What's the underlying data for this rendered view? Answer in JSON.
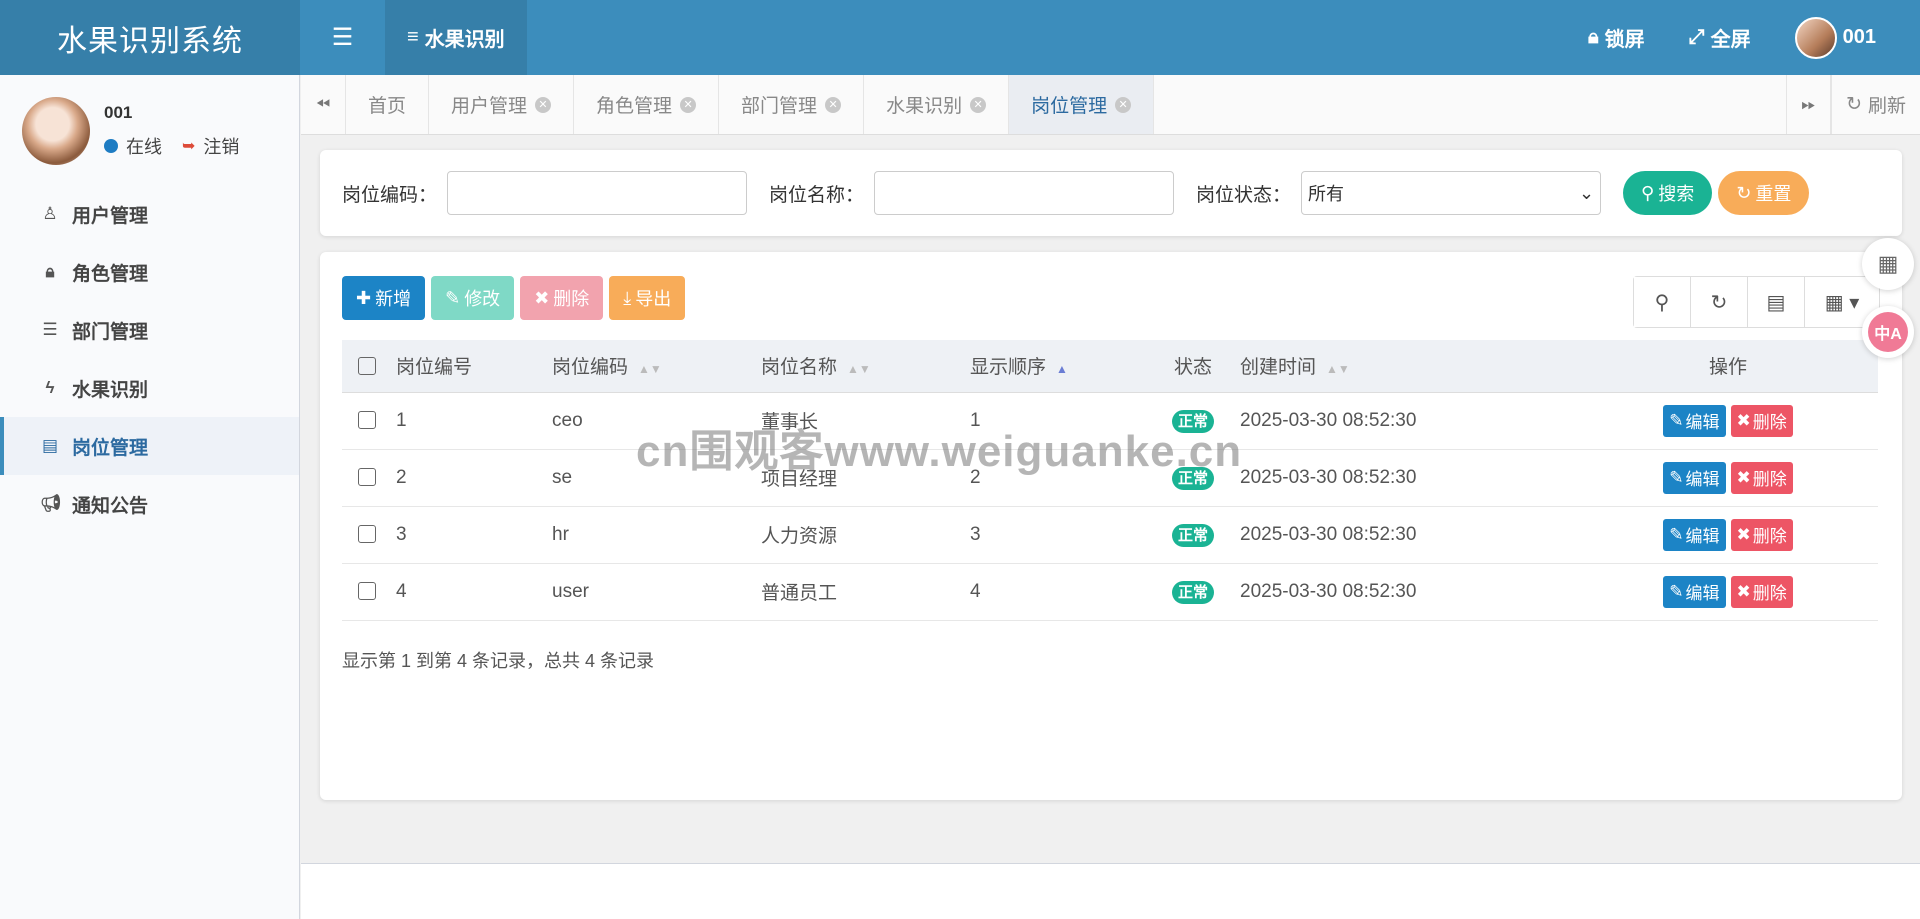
{
  "app": {
    "title": "水果识别系统"
  },
  "topbar": {
    "menu_tab": "水果识别",
    "lock_label": "锁屏",
    "fullscreen_label": "全屏",
    "user_label": "001"
  },
  "sidebar": {
    "user": {
      "name": "001",
      "status": "在线",
      "logout": "注销"
    },
    "items": [
      {
        "label": "用户管理",
        "icon": "user-icon"
      },
      {
        "label": "角色管理",
        "icon": "lock-icon"
      },
      {
        "label": "部门管理",
        "icon": "outdent-icon"
      },
      {
        "label": "水果识别",
        "icon": "bolt-icon"
      },
      {
        "label": "岗位管理",
        "icon": "id-card-icon",
        "active": true
      },
      {
        "label": "通知公告",
        "icon": "bullhorn-icon"
      }
    ]
  },
  "tabs": {
    "items": [
      "首页",
      "用户管理",
      "角色管理",
      "部门管理",
      "水果识别",
      "岗位管理"
    ],
    "active": "岗位管理",
    "refresh_label": "刷新"
  },
  "search": {
    "post_code_label": "岗位编码：",
    "post_code_value": "",
    "post_name_label": "岗位名称：",
    "post_name_value": "",
    "status_label": "岗位状态：",
    "status_selected": "所有",
    "search_button": "搜索",
    "reset_button": "重置"
  },
  "toolbar": {
    "add": "新增",
    "edit": "修改",
    "delete": "删除",
    "export": "导出"
  },
  "table": {
    "columns": [
      "岗位编号",
      "岗位编码",
      "岗位名称",
      "显示顺序",
      "状态",
      "创建时间",
      "操作"
    ],
    "rows": [
      {
        "id": "1",
        "code": "ceo",
        "name": "董事长",
        "order": "1",
        "status": "正常",
        "created": "2025-03-30 08:52:30"
      },
      {
        "id": "2",
        "code": "se",
        "name": "项目经理",
        "order": "2",
        "status": "正常",
        "created": "2025-03-30 08:52:30"
      },
      {
        "id": "3",
        "code": "hr",
        "name": "人力资源",
        "order": "3",
        "status": "正常",
        "created": "2025-03-30 08:52:30"
      },
      {
        "id": "4",
        "code": "user",
        "name": "普通员工",
        "order": "4",
        "status": "正常",
        "created": "2025-03-30 08:52:30"
      }
    ],
    "edit_label": "编辑",
    "delete_label": "删除",
    "summary": "显示第 1 到第 4 条记录，总共 4 条记录"
  },
  "watermark": "cn围观客www.weiguanke.cn",
  "translate_badge": "中A",
  "colors": {
    "primary": "#3c8dbc",
    "success": "#1ab394",
    "danger": "#ed5565",
    "warning": "#f8ac59",
    "info": "#1c84c6"
  }
}
